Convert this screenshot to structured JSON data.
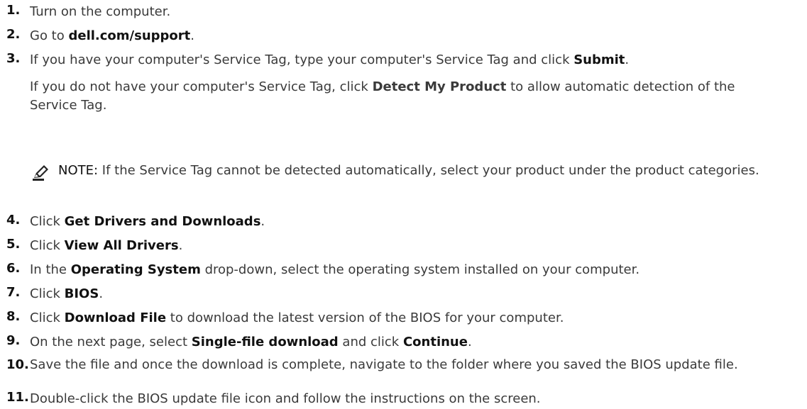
{
  "steps": [
    {
      "num": "1.",
      "parts": [
        {
          "t": "Turn on the computer."
        }
      ]
    },
    {
      "num": "2.",
      "parts": [
        {
          "t": "Go to "
        },
        {
          "t": "dell.com/support",
          "b": true
        },
        {
          "t": "."
        }
      ]
    },
    {
      "num": "3.",
      "parts": [
        {
          "t": "If you have your computer's Service Tag, type your computer's Service Tag and click "
        },
        {
          "t": "Submit",
          "b": true
        },
        {
          "t": "."
        }
      ]
    },
    {
      "num": "4.",
      "parts": [
        {
          "t": "Click "
        },
        {
          "t": "Get Drivers and Downloads",
          "b": true
        },
        {
          "t": "."
        }
      ]
    },
    {
      "num": "5.",
      "parts": [
        {
          "t": "Click "
        },
        {
          "t": "View All Drivers",
          "b": true
        },
        {
          "t": "."
        }
      ]
    },
    {
      "num": "6.",
      "parts": [
        {
          "t": "In the "
        },
        {
          "t": "Operating System",
          "b": true
        },
        {
          "t": " drop-down, select the operating system installed on your computer."
        }
      ]
    },
    {
      "num": "7.",
      "parts": [
        {
          "t": "Click "
        },
        {
          "t": "BIOS",
          "b": true
        },
        {
          "t": "."
        }
      ]
    },
    {
      "num": "8.",
      "parts": [
        {
          "t": "Click "
        },
        {
          "t": "Download File",
          "b": true
        },
        {
          "t": " to download the latest version of the BIOS for your computer."
        }
      ]
    },
    {
      "num": "9.",
      "parts": [
        {
          "t": "On the next page, select "
        },
        {
          "t": "Single-file download",
          "b": true
        },
        {
          "t": " and click "
        },
        {
          "t": "Continue",
          "b": true
        },
        {
          "t": "."
        }
      ]
    },
    {
      "num": "10.",
      "parts": [
        {
          "t": "Save the file and once the download is complete, navigate to the folder where you saved the BIOS update file."
        }
      ]
    },
    {
      "num": "11.",
      "parts": [
        {
          "t": "Double-click the BIOS update file icon and follow the instructions on the screen."
        }
      ]
    }
  ],
  "step3_extra": [
    {
      "t": "If you do not have your computer's Service Tag, click "
    },
    {
      "t": "Detect My Product",
      "b": true
    },
    {
      "t": " to allow automatic detection of the Service Tag."
    }
  ],
  "note": {
    "label": "NOTE:",
    "text": " If the Service Tag cannot be detected automatically, select your product under the product categories.",
    "icon": "pencil-icon"
  }
}
